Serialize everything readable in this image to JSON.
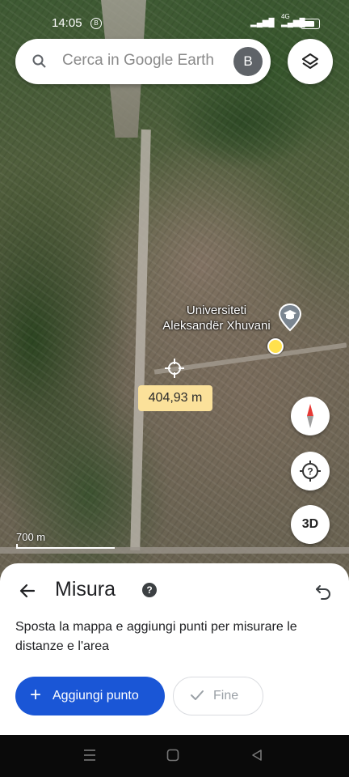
{
  "status_bar": {
    "time": "14:05",
    "badge": "B",
    "network": "4G"
  },
  "search": {
    "placeholder": "Cerca in Google Earth",
    "avatar_letter": "B"
  },
  "map": {
    "place_label": "Universiteti Aleksandër Xhuvani",
    "distance": "404,93 m",
    "scale": "700 m",
    "three_d_label": "3D"
  },
  "sheet": {
    "title": "Misura",
    "description": "Sposta la mappa e aggiungi punti per misurare le distanze e l'area",
    "add_button": "Aggiungi punto",
    "done_button": "Fine"
  },
  "colors": {
    "primary": "#1a56d6",
    "distance_chip": "#fbe19a",
    "marker": "#ffe14d"
  },
  "icons": [
    "search-icon",
    "layers-icon",
    "school-pin-icon",
    "crosshair-icon",
    "compass-icon",
    "location-help-icon",
    "back-arrow-icon",
    "help-icon",
    "undo-icon",
    "plus-icon",
    "check-icon",
    "recents-icon",
    "home-icon",
    "back-icon"
  ]
}
